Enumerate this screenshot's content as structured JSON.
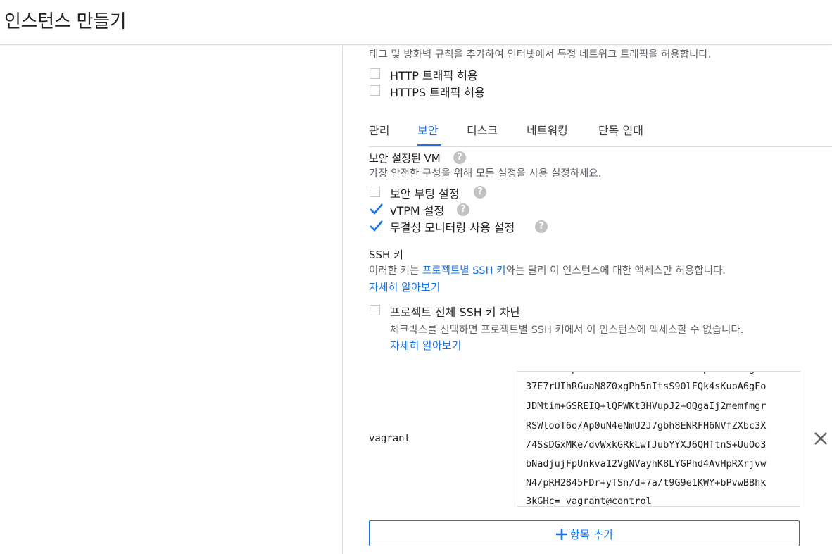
{
  "header": {
    "title": "인스턴스 만들기"
  },
  "firewall": {
    "description": "태그 및 방화벽 규칙을 추가하여 인터넷에서 특정 네트워크 트래픽을 허용합니다.",
    "http_label": "HTTP 트래픽 허용",
    "http_checked": false,
    "https_label": "HTTPS 트래픽 허용",
    "https_checked": false
  },
  "tabs": [
    {
      "label": "관리",
      "active": false
    },
    {
      "label": "보안",
      "active": true
    },
    {
      "label": "디스크",
      "active": false
    },
    {
      "label": "네트워킹",
      "active": false
    },
    {
      "label": "단독 임대",
      "active": false
    }
  ],
  "shielded_vm": {
    "title": "보안 설정된 VM",
    "help_icon": "help-circle-icon",
    "description": "가장 안전한 구성을 위해 모든 설정을 사용 설정하세요.",
    "options": [
      {
        "label": "보안 부팅 설정",
        "checked": false
      },
      {
        "label": "vTPM 설정",
        "checked": true
      },
      {
        "label": "무결성 모니터링 사용 설정",
        "checked": true
      }
    ]
  },
  "ssh": {
    "title": "SSH 키",
    "desc_prefix": "이러한 키는 ",
    "desc_link": "프로젝트별 SSH 키",
    "desc_suffix": "와는 달리 이 인스턴스에 대한 액세스만 허용합니다.",
    "learn_more": "자세히 알아보기",
    "block_label": "프로젝트 전체 SSH 키 차단",
    "block_checked": false,
    "block_description": "체크박스를 선택하면 프로젝트별 SSH 키에서 이 인스턴스에 액세스할 수 없습니다.",
    "block_learn_more": "자세히 알아보기",
    "entry": {
      "username": "vagrant",
      "key_lines": [
        "37E7rUIhRGuaN8Z0xgPh5nItsS90lFQk4sKupA6gFo",
        "JDMtim+GSREIQ+lQPWKt3HVupJ2+OQgaIj2memfmgr",
        "RSWlooT6o/Ap0uN4eNmU2J7gbh8ENRFH6NVfZXbc3X",
        "/4SsDGxMKe/dvWxkGRkLwTJubYYXJ6QHTtnS+UuOo3",
        "bNadjujFpUnkva12VgNVayhK8LYGPhd4AvHpRXrjvw",
        "N4/pRH2845FDr+yTSn/d+7a/t9G9e1KWY+bPvwBBhk",
        "3kGHc= vagrant@control"
      ]
    },
    "add_item_label": "항목 추가"
  },
  "colors": {
    "accent": "#1a73e8",
    "border": "#dadce0",
    "help_gray": "#c2c2c2"
  }
}
